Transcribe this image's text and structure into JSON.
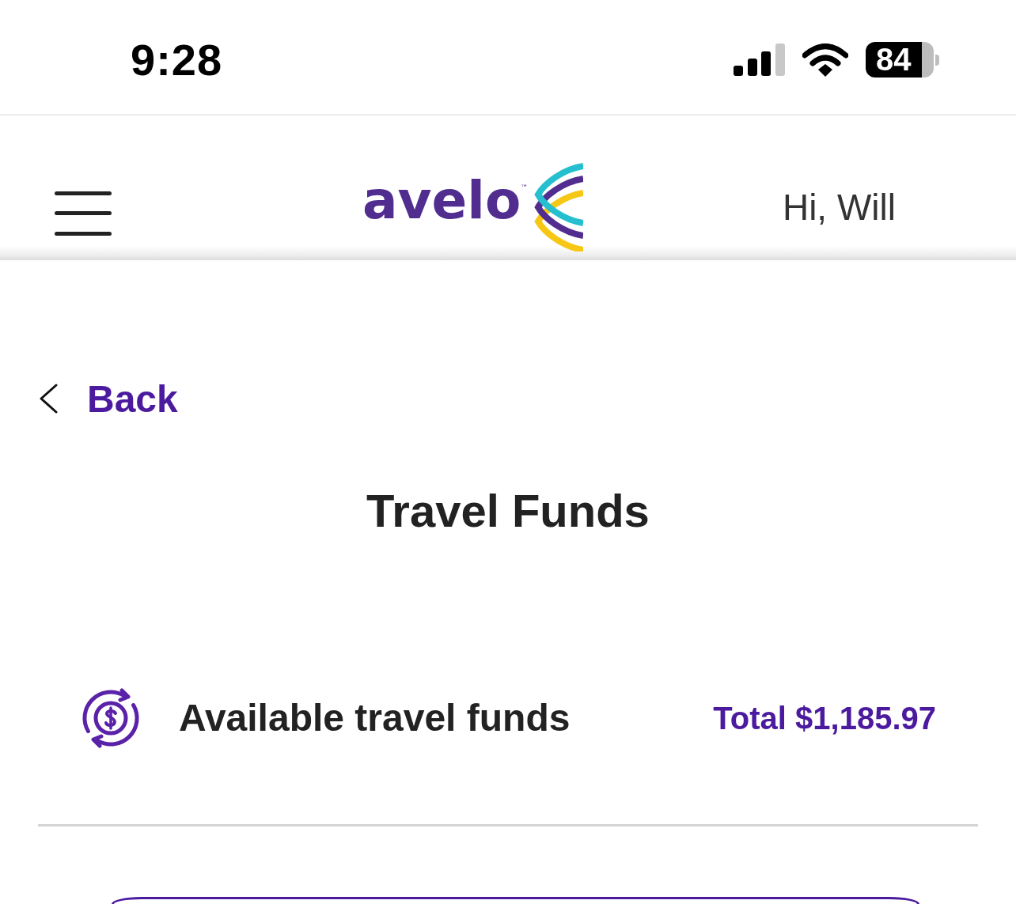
{
  "status_bar": {
    "time": "9:28",
    "battery": "84"
  },
  "header": {
    "logo": {
      "wordmark": "avelo",
      "trademark": "™"
    },
    "greeting": "Hi, Will"
  },
  "back_link": {
    "label": "Back"
  },
  "page_title": "Travel Funds",
  "funds": {
    "label": "Available travel funds",
    "total": "Total $1,185.97"
  }
}
